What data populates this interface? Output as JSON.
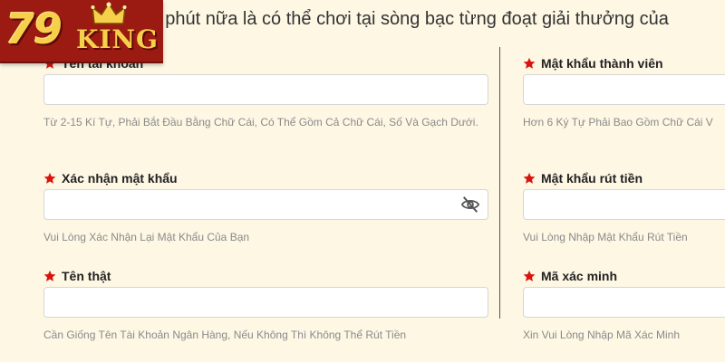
{
  "header": {
    "banner_text": "ột phút nữa là có thể chơi tại sòng bạc từng đoạt giải thưởng của",
    "logo_number": "79",
    "logo_word": "KING"
  },
  "colors": {
    "background": "#fdf7e4",
    "required_star": "#d9140d",
    "logo_bg": "#9b1b12",
    "logo_gold": "#f7d04b"
  },
  "left_column": {
    "username": {
      "label": "Tên tài khoản",
      "value": "",
      "hint": "Từ 2-15 Kí Tự, Phải Bắt Đầu Bằng Chữ Cái, Có Thể Gồm Cả Chữ Cái, Số Và Gạch Dưới."
    },
    "confirm_password": {
      "label": "Xác nhận mật khẩu",
      "value": "",
      "hint": "Vui Lòng Xác Nhận Lại Mật Khẩu Của Bạn",
      "icon": "eye-slash-icon"
    },
    "real_name": {
      "label": "Tên thật",
      "value": "",
      "hint": "Cần Giống Tên Tài Khoản Ngân Hàng, Nếu Không Thì Không Thể Rút Tiền"
    }
  },
  "right_column": {
    "member_password": {
      "label": "Mật khẩu thành viên",
      "value": "",
      "hint": "Hơn 6 Ký Tự Phải Bao Gồm Chữ Cái V"
    },
    "withdraw_password": {
      "label": "Mật khẩu rút tiền",
      "value": "",
      "hint": "Vui Lòng Nhập Mật Khẩu Rút Tiền"
    },
    "verification_code": {
      "label": "Mã xác minh",
      "value": "",
      "hint": "Xin Vui Lòng Nhập Mã Xác Minh"
    }
  }
}
